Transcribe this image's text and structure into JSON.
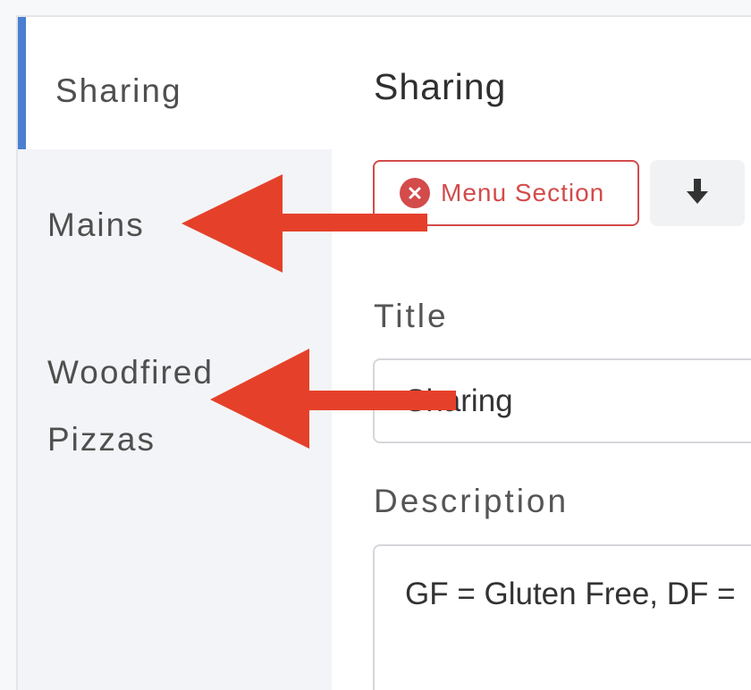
{
  "sidebar": {
    "items": [
      {
        "label": "Sharing",
        "active": true
      },
      {
        "label": "Mains",
        "active": false
      },
      {
        "label": "Woodfired Pizzas",
        "active": false
      }
    ]
  },
  "main": {
    "title": "Sharing",
    "remove_button_label": "Menu Section",
    "move_down_icon": "arrow-down-icon",
    "title_field": {
      "label": "Title",
      "value": "Sharing"
    },
    "description_field": {
      "label": "Description",
      "value": "GF = Gluten Free, DF ="
    }
  },
  "annotations": {
    "arrow_color": "#e5412a",
    "icon": "left-pointing-arrow"
  },
  "colors": {
    "accent": "#4a7fd2",
    "danger": "#d34b4b",
    "sidebar_bg": "#f3f4f7"
  }
}
